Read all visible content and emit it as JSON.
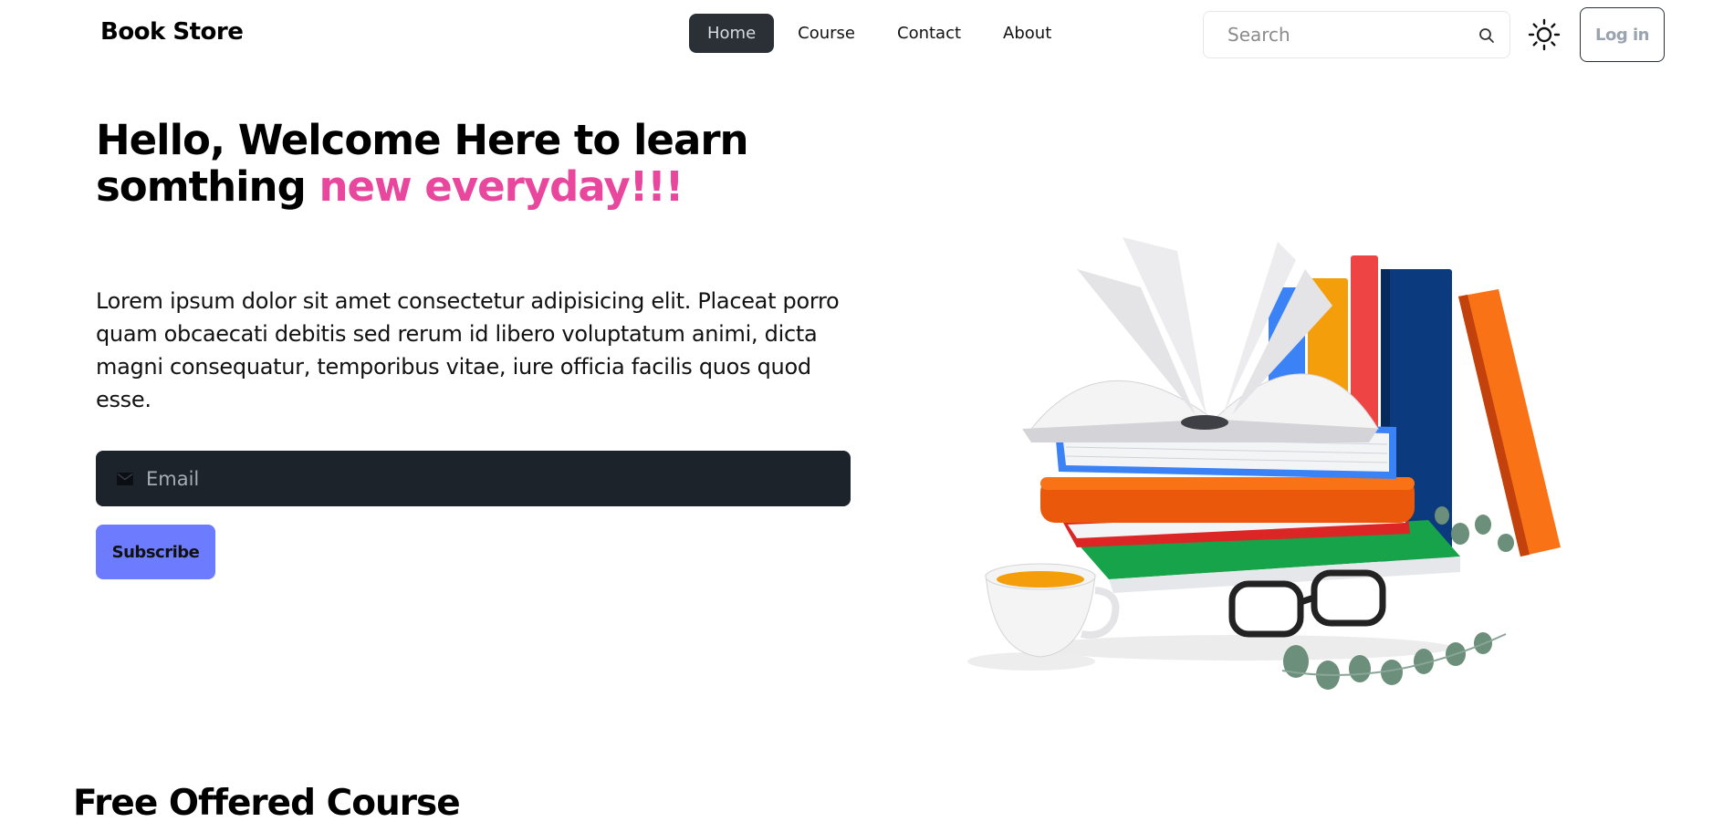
{
  "navbar": {
    "brand": "Book Store",
    "links": [
      {
        "label": "Home",
        "active": true
      },
      {
        "label": "Course",
        "active": false
      },
      {
        "label": "Contact",
        "active": false
      },
      {
        "label": "About",
        "active": false
      }
    ],
    "search_placeholder": "Search",
    "theme_icon": "sun-icon",
    "login_label": "Log in"
  },
  "hero": {
    "title_line1": "Hello, Welcome Here to learn",
    "title_line2_prefix": "somthing ",
    "title_highlight": "new everyday!!!",
    "description": "Lorem ipsum dolor sit amet consectetur adipisicing elit. Placeat porro quam obcaecati debitis sed rerum id libero voluptatum animi, dicta magni consequatur, temporibus vitae, iure officia facilis quos quod esse.",
    "email_placeholder": "Email",
    "subscribe_label": "Subscribe",
    "image_icon": "books-illustration"
  },
  "section": {
    "title": "Free Offered Course"
  },
  "colors": {
    "accent_pink": "#e9479d",
    "button_indigo": "#6d7cff",
    "dark": "#1d232a",
    "nav_active_bg": "#2b2f36"
  }
}
